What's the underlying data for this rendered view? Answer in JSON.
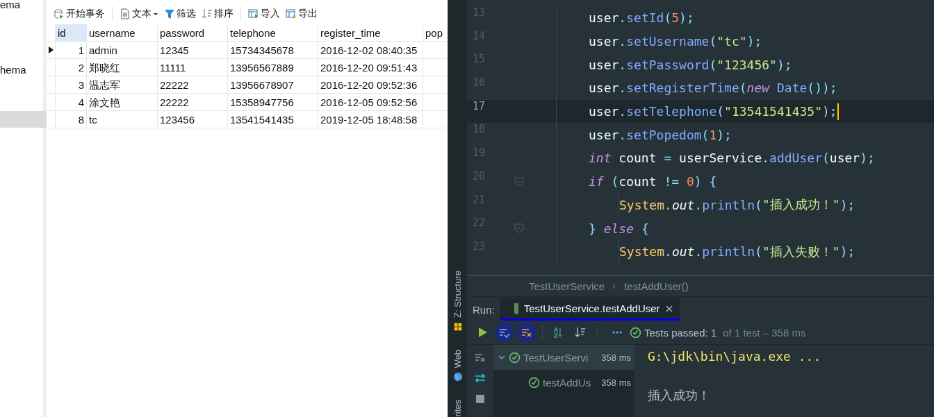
{
  "navigator": {
    "items": [
      {
        "label": "ema",
        "selected": false
      },
      {
        "label": "hema",
        "selected": false
      },
      {
        "selected": true
      }
    ]
  },
  "grid_toolbar": [
    {
      "kind": "transaction",
      "label": "开始事务"
    },
    {
      "kind": "text",
      "label": "文本",
      "dropdown": true
    },
    {
      "kind": "filter",
      "label": "筛选"
    },
    {
      "kind": "sort",
      "label": "排序"
    },
    {
      "kind": "import",
      "label": "导入"
    },
    {
      "kind": "export",
      "label": "导出"
    }
  ],
  "table": {
    "columns": [
      {
        "label": "id",
        "selected": true
      },
      {
        "label": "username",
        "selected": false
      },
      {
        "label": "password",
        "selected": false
      },
      {
        "label": "telephone",
        "selected": false
      },
      {
        "label": "register_time",
        "selected": false
      },
      {
        "label": "pop",
        "selected": false
      }
    ],
    "rows": [
      {
        "selected": true,
        "cells": [
          "1",
          "admin",
          "12345",
          "15734345678",
          "2016-12-02 08:40:35"
        ]
      },
      {
        "selected": false,
        "cells": [
          "2",
          "郑晓红",
          "11111",
          "13956567889",
          "2016-12-20 09:51:43"
        ]
      },
      {
        "selected": false,
        "cells": [
          "3",
          "温志军",
          "22222",
          "13956678907",
          "2016-12-20 09:52:36"
        ]
      },
      {
        "selected": false,
        "cells": [
          "4",
          "涂文艳",
          "22222",
          "15358947756",
          "2016-12-05 09:52:56"
        ]
      },
      {
        "selected": false,
        "cells": [
          "8",
          "tc",
          "123456",
          "13541541435",
          "2019-12-05 18:48:58"
        ]
      }
    ]
  },
  "side_strip": [
    {
      "kind": "structure",
      "label": "Z: Structure"
    },
    {
      "kind": "web",
      "label": "Web"
    },
    {
      "kind": "favorites",
      "label": "rites"
    }
  ],
  "editor": {
    "lines": [
      {
        "number": "13",
        "current": false,
        "fold": false,
        "tokens": [
          {
            "kind": "plain",
            "text": "user"
          },
          {
            "kind": "punct",
            "text": "."
          },
          {
            "kind": "method",
            "text": "setId"
          },
          {
            "kind": "punct",
            "text": "("
          },
          {
            "kind": "num",
            "text": "5"
          },
          {
            "kind": "punct",
            "text": ");"
          }
        ]
      },
      {
        "number": "14",
        "current": false,
        "fold": false,
        "tokens": [
          {
            "kind": "plain",
            "text": "user"
          },
          {
            "kind": "punct",
            "text": "."
          },
          {
            "kind": "method",
            "text": "setUsername"
          },
          {
            "kind": "punct",
            "text": "("
          },
          {
            "kind": "str",
            "text": "\"tc\""
          },
          {
            "kind": "punct",
            "text": ");"
          }
        ]
      },
      {
        "number": "15",
        "current": false,
        "fold": false,
        "tokens": [
          {
            "kind": "plain",
            "text": "user"
          },
          {
            "kind": "punct",
            "text": "."
          },
          {
            "kind": "method",
            "text": "setPassword"
          },
          {
            "kind": "punct",
            "text": "("
          },
          {
            "kind": "str",
            "text": "\"123456\""
          },
          {
            "kind": "punct",
            "text": ");"
          }
        ]
      },
      {
        "number": "16",
        "current": false,
        "fold": false,
        "tokens": [
          {
            "kind": "plain",
            "text": "user"
          },
          {
            "kind": "punct",
            "text": "."
          },
          {
            "kind": "method",
            "text": "setRegisterTime"
          },
          {
            "kind": "punct",
            "text": "("
          },
          {
            "kind": "kw",
            "text": "new"
          },
          {
            "kind": "method",
            "text": " Date"
          },
          {
            "kind": "punct",
            "text": "());"
          }
        ]
      },
      {
        "number": "17",
        "current": true,
        "fold": false,
        "tokens": [
          {
            "kind": "plain",
            "text": "user"
          },
          {
            "kind": "punct",
            "text": "."
          },
          {
            "kind": "method",
            "text": "setTelephone"
          },
          {
            "kind": "punct",
            "text": "("
          },
          {
            "kind": "str",
            "text": "\"13541541435\""
          },
          {
            "kind": "punct",
            "text": ");"
          }
        ]
      },
      {
        "number": "18",
        "current": false,
        "fold": false,
        "tokens": [
          {
            "kind": "plain",
            "text": "user"
          },
          {
            "kind": "punct",
            "text": "."
          },
          {
            "kind": "method",
            "text": "setPopedom"
          },
          {
            "kind": "punct",
            "text": "("
          },
          {
            "kind": "num",
            "text": "1"
          },
          {
            "kind": "punct",
            "text": ");"
          }
        ]
      },
      {
        "number": "19",
        "current": false,
        "fold": false,
        "tokens": [
          {
            "kind": "kw",
            "text": "int"
          },
          {
            "kind": "plain",
            "text": " count "
          },
          {
            "kind": "punct",
            "text": "="
          },
          {
            "kind": "plain",
            "text": " userService"
          },
          {
            "kind": "punct",
            "text": "."
          },
          {
            "kind": "method",
            "text": "addUser"
          },
          {
            "kind": "punct",
            "text": "("
          },
          {
            "kind": "plain",
            "text": "user"
          },
          {
            "kind": "punct",
            "text": ");"
          }
        ]
      },
      {
        "number": "20",
        "current": false,
        "fold": true,
        "tokens": [
          {
            "kind": "kw",
            "text": "if"
          },
          {
            "kind": "punct",
            "text": " ("
          },
          {
            "kind": "plain",
            "text": "count "
          },
          {
            "kind": "punct",
            "text": "!="
          },
          {
            "kind": "num",
            "text": " 0"
          },
          {
            "kind": "punct",
            "text": ") {"
          }
        ],
        "children": [
          {
            "number": "21",
            "current": false,
            "fold": false,
            "tokens": [
              {
                "kind": "cls",
                "text": "System"
              },
              {
                "kind": "punct",
                "text": "."
              },
              {
                "kind": "field",
                "text": "out"
              },
              {
                "kind": "punct",
                "text": "."
              },
              {
                "kind": "method",
                "text": "println"
              },
              {
                "kind": "punct",
                "text": "("
              },
              {
                "kind": "str",
                "text": "\"插入成功！\""
              },
              {
                "kind": "punct",
                "text": ");"
              }
            ]
          }
        ]
      },
      {
        "number": "22",
        "current": false,
        "fold": true,
        "tokens": [
          {
            "kind": "punct",
            "text": "} "
          },
          {
            "kind": "kw",
            "text": "else"
          },
          {
            "kind": "punct",
            "text": " {"
          }
        ],
        "children": [
          {
            "number": "23",
            "current": false,
            "fold": false,
            "tokens": [
              {
                "kind": "cls",
                "text": "System"
              },
              {
                "kind": "punct",
                "text": "."
              },
              {
                "kind": "field",
                "text": "out"
              },
              {
                "kind": "punct",
                "text": "."
              },
              {
                "kind": "method",
                "text": "println"
              },
              {
                "kind": "punct",
                "text": "("
              },
              {
                "kind": "str",
                "text": "\"插入失败！\""
              },
              {
                "kind": "punct",
                "text": ");"
              }
            ]
          }
        ]
      }
    ]
  },
  "breadcrumb": [
    "TestUserService",
    "testAddUser()"
  ],
  "run_panel": {
    "label": "Run:",
    "tab": {
      "label": "TestUserService.testAddUser",
      "selected": true
    },
    "toolbar": [
      {
        "kind": "run",
        "selected": false
      },
      {
        "kind": "show-passed",
        "selected": true
      },
      {
        "kind": "show-ignored",
        "selected": true
      },
      {
        "kind": "sort-alpha",
        "selected": false
      },
      {
        "kind": "sort-duration",
        "selected": false
      },
      {
        "kind": "more",
        "selected": false
      }
    ],
    "status": "Tests passed: 1",
    "status_detail": "of 1 test – 358 ms",
    "side_actions": [
      {
        "kind": "collapse"
      },
      {
        "kind": "toggle"
      },
      {
        "kind": "stop"
      }
    ],
    "tree": [
      {
        "label": "TestUserServi",
        "time": "358 ms",
        "expanded": true,
        "selected": true,
        "children": [
          {
            "label": "testAddUs",
            "time": "358 ms",
            "selected": false
          }
        ]
      }
    ],
    "console": [
      {
        "kind": "command",
        "text": "G:\\jdk\\bin\\java.exe ..."
      },
      {
        "kind": "output",
        "text": "插入成功！"
      }
    ]
  }
}
